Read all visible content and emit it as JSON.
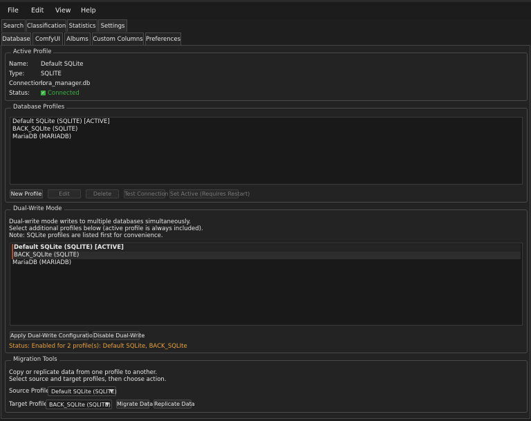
{
  "menu": {
    "file": "File",
    "edit": "Edit",
    "view": "View",
    "help": "Help"
  },
  "main_tabs": {
    "search": "Search",
    "classification": "Classification",
    "statistics": "Statistics",
    "settings": "Settings"
  },
  "sub_tabs": {
    "database": "Database",
    "comfyui": "ComfyUI",
    "albums": "Albums",
    "custom_columns": "Custom Columns",
    "preferences": "Preferences"
  },
  "active_profile": {
    "title": "Active Profile",
    "name_label": "Name:",
    "name": "Default SQLite",
    "type_label": "Type:",
    "type": "SQLITE",
    "connection_label": "Connection:",
    "connection": "lora_manager.db",
    "status_label": "Status:",
    "status": "Connected",
    "status_color": "#3cb043"
  },
  "db_profiles": {
    "title": "Database Profiles",
    "items": [
      "Default SQLite (SQLITE) [ACTIVE]",
      "BACK_SQLIte (SQLITE)",
      "MariaDB (MARIADB)"
    ],
    "buttons": {
      "new": "New Profile",
      "edit": "Edit",
      "delete": "Delete",
      "test": "Test Connection",
      "set_active": "Set Active (Requires Restart)"
    }
  },
  "dual_write": {
    "title": "Dual-Write Mode",
    "desc1": "Dual-write mode writes to multiple databases simultaneously.",
    "desc2": "Select additional profiles below (active profile is always included).",
    "desc3": "Note: SQLite profiles are listed first for convenience.",
    "items": [
      "Default SQLite (SQLITE) [ACTIVE]",
      "BACK_SQLIte (SQLITE)",
      "MariaDB (MARIADB)"
    ],
    "buttons": {
      "apply": "Apply Dual-Write Configuration",
      "disable": "Disable Dual-Write"
    },
    "status": "Status: Enabled for 2 profile(s): Default SQLite, BACK_SQLIte",
    "status_color": "#e8a33a"
  },
  "migration": {
    "title": "Migration Tools",
    "desc1": "Copy or replicate data from one profile to another.",
    "desc2": "Select source and target profiles, then choose action.",
    "source_label": "Source Profile:",
    "source_value": "Default SQLite (SQLITE)",
    "target_label": "Target Profile:",
    "target_value": "BACK_SQLIte (SQLITE)",
    "buttons": {
      "migrate": "Migrate Data",
      "replicate": "Replicate Data"
    }
  }
}
